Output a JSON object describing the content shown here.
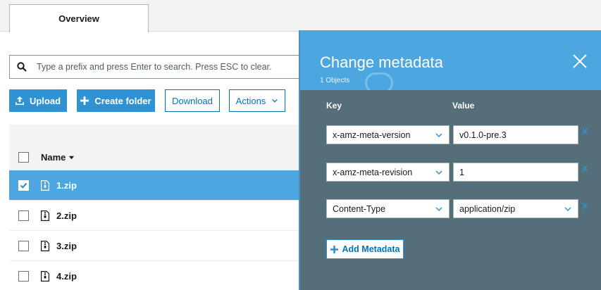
{
  "tabs": [
    {
      "label": "Overview"
    }
  ],
  "search": {
    "placeholder": "Type a prefix and press Enter to search. Press ESC to clear."
  },
  "toolbar": {
    "upload": "Upload",
    "create_folder": "Create folder",
    "download": "Download",
    "actions": "Actions"
  },
  "table": {
    "column_name": "Name",
    "rows": [
      {
        "name": "1.zip",
        "selected": true
      },
      {
        "name": "2.zip",
        "selected": false
      },
      {
        "name": "3.zip",
        "selected": false
      },
      {
        "name": "4.zip",
        "selected": false
      }
    ]
  },
  "panel": {
    "title": "Change metadata",
    "subtitle": "1 Objects",
    "key_label": "Key",
    "value_label": "Value",
    "entries": [
      {
        "key": "x-amz-meta-version",
        "value": "v0.1.0-pre.3",
        "remove": "X"
      },
      {
        "key": "x-amz-meta-revision",
        "value": "1",
        "remove": "X"
      },
      {
        "key": "Content-Type",
        "value": "application/zip",
        "remove": "X"
      }
    ],
    "add_label": "Add Metadata"
  },
  "colors": {
    "accent": "#2f93d3",
    "panel_header": "#4ca7e0",
    "panel_body": "#546e7a",
    "selected_row": "#4ca7e0"
  },
  "icons": [
    "search-icon",
    "upload-icon",
    "plus-icon",
    "chevron-down-icon",
    "sort-down-icon",
    "checkbox-check-icon",
    "zip-file-icon",
    "close-icon"
  ]
}
